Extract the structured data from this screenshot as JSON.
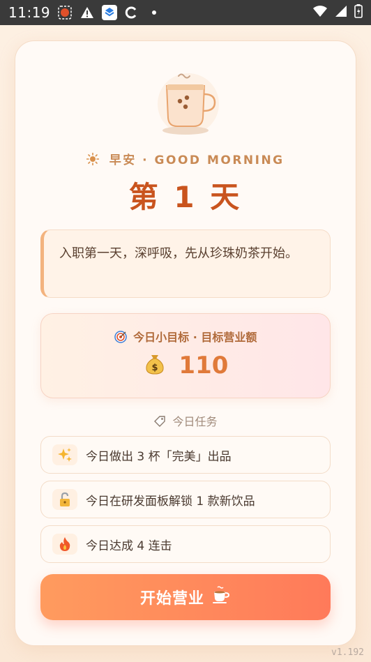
{
  "statusbar": {
    "time": "11:19"
  },
  "greeting": "早安 · GOOD MORNING",
  "day_title": "第 1 天",
  "intro_text": "入职第一天，深呼吸，先从珍珠奶茶开始。",
  "goal": {
    "label": "今日小目标 · 目标营业额",
    "value": "110"
  },
  "tasks_title": "今日任务",
  "tasks": [
    {
      "icon": "sparkles-icon",
      "text": "今日做出 3 杯「完美」出品"
    },
    {
      "icon": "unlock-icon",
      "text": "今日在研发面板解锁 1 款新饮品"
    },
    {
      "icon": "fire-icon",
      "text": "今日达成 4 连击"
    }
  ],
  "start_button": "开始营业",
  "version": "v1.192",
  "colors": {
    "accent": "#c9541e",
    "button_start": "#ff9b5e",
    "button_end": "#ff7a5a",
    "goal_value": "#e07a3a"
  }
}
